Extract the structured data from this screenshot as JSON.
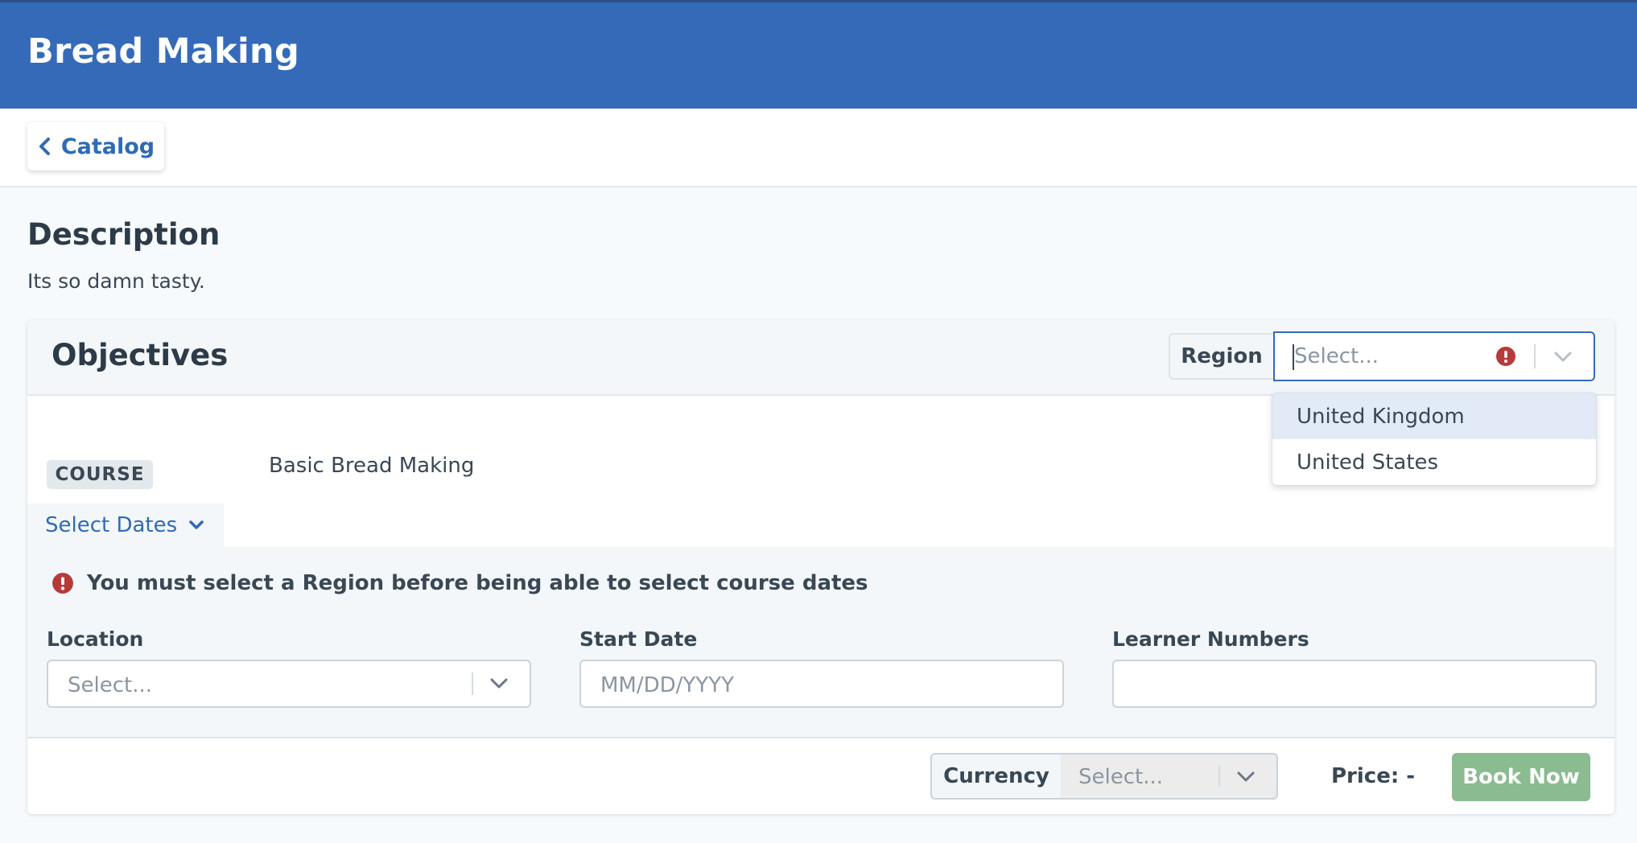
{
  "header": {
    "title": "Bread Making"
  },
  "nav": {
    "back_label": "Catalog"
  },
  "description": {
    "heading": "Description",
    "text": "Its so damn tasty."
  },
  "objectives": {
    "title": "Objectives",
    "region": {
      "label": "Region",
      "placeholder": "Select...",
      "options": [
        "United Kingdom",
        "United States"
      ],
      "highlighted_option": "United Kingdom"
    },
    "course": {
      "badge": "COURSE",
      "name": "Basic Bread Making"
    },
    "select_dates": {
      "label": "Select Dates",
      "warning": "You must select a Region before being able to select course dates",
      "location": {
        "label": "Location",
        "placeholder": "Select..."
      },
      "start_date": {
        "label": "Start Date",
        "placeholder": "MM/DD/YYYY"
      },
      "learner_numbers": {
        "label": "Learner Numbers",
        "value": ""
      }
    },
    "footer": {
      "currency_label": "Currency",
      "currency_placeholder": "Select...",
      "price_text": "Price: -",
      "book_label": "Book Now"
    }
  },
  "colors": {
    "header_bg": "#356ab8",
    "link": "#2f6bb3",
    "error": "#b73a3a",
    "book_button": "#8bbb90",
    "dropdown_highlight": "#e1eaf6"
  },
  "icons": {
    "back": "chevron-left-icon",
    "error": "exclamation-circle-icon",
    "dropdown": "chevron-down-icon"
  }
}
